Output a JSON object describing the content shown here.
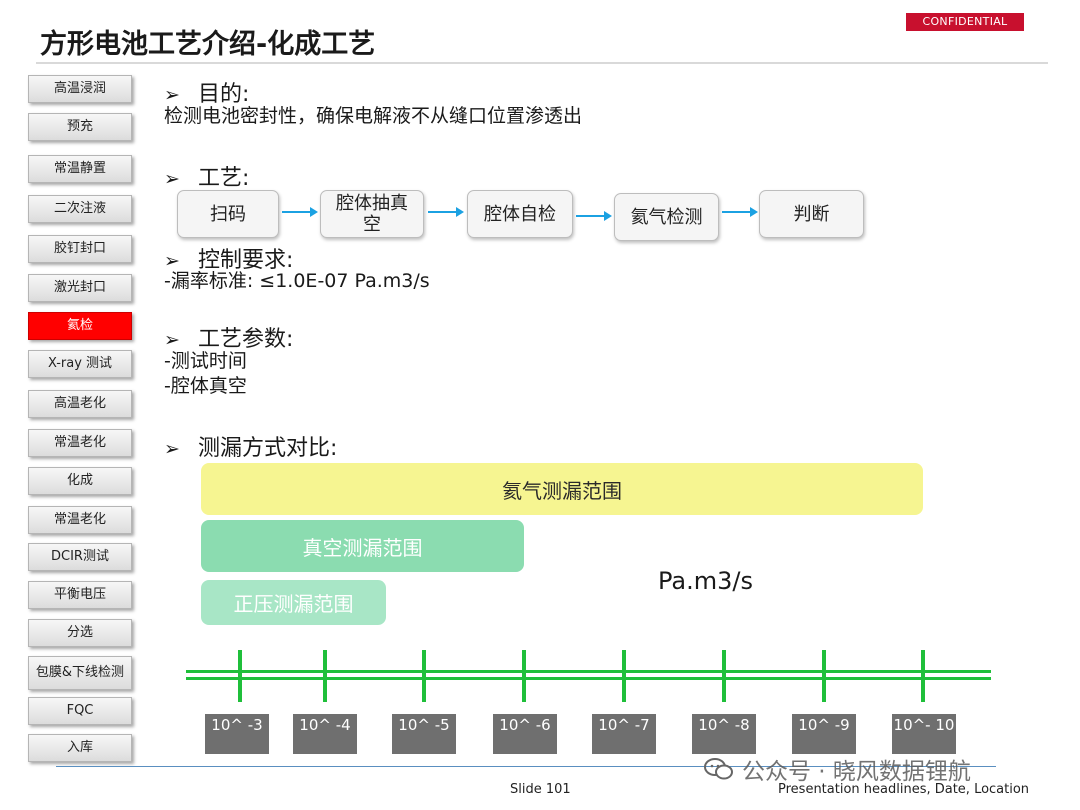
{
  "header": {
    "confidential": "CONFIDENTIAL",
    "title": "方形电池工艺介绍-化成工艺"
  },
  "sidebar": {
    "items": [
      {
        "label": "高温浸润",
        "active": false
      },
      {
        "label": "预充",
        "active": false
      },
      {
        "label": "常温静置",
        "active": false
      },
      {
        "label": "二次注液",
        "active": false
      },
      {
        "label": "胶钉封口",
        "active": false
      },
      {
        "label": "激光封口",
        "active": false
      },
      {
        "label": "氦检",
        "active": true
      },
      {
        "label": "X-ray 测试",
        "active": false
      },
      {
        "label": "高温老化",
        "active": false
      },
      {
        "label": "常温老化",
        "active": false
      },
      {
        "label": "化成",
        "active": false
      },
      {
        "label": "常温老化",
        "active": false
      },
      {
        "label": "DCIR测试",
        "active": false
      },
      {
        "label": "平衡电压",
        "active": false
      },
      {
        "label": "分选",
        "active": false
      },
      {
        "label": "包膜&下线检测",
        "active": false
      },
      {
        "label": "FQC",
        "active": false
      },
      {
        "label": "入库",
        "active": false
      }
    ]
  },
  "content": {
    "bullet_glyph": "➢",
    "purpose": {
      "heading": "目的:",
      "text": "检测电池密封性，确保电解液不从缝口位置渗透出"
    },
    "process": {
      "heading": "工艺:",
      "steps": [
        "扫码",
        "腔体抽真空",
        "腔体自检",
        "氦气检测",
        "判断"
      ]
    },
    "control": {
      "heading": "控制要求:",
      "text": "-漏率标准:   ≤1.0E-07 Pa.m3/s"
    },
    "params": {
      "heading": "工艺参数:",
      "lines": [
        "-测试时间",
        "-腔体真空"
      ]
    },
    "compare": {
      "heading": "测漏方式对比:",
      "ranges": [
        "氦气测漏范围",
        "真空测漏范围",
        "正压测漏范围"
      ],
      "unit": "Pa.m3/s",
      "scale_labels": [
        "10^ -3",
        "10^ -4",
        "10^ -5",
        "10^ -6",
        "10^ -7",
        "10^ -8",
        "10^ -9",
        "10^- 10"
      ]
    }
  },
  "footer": {
    "slide": "Slide 101",
    "right": "Presentation headlines, Date, Location",
    "watermark": "公众号 · 晓风数据锂航"
  },
  "colors": {
    "accent_red": "#ff0000",
    "confidential_red": "#c8102e",
    "scale_green": "#1fbf3a",
    "helium_range": "#f6f591",
    "vacuum_range": "#8bdcb0",
    "flow_arrow": "#1ba1e2"
  }
}
